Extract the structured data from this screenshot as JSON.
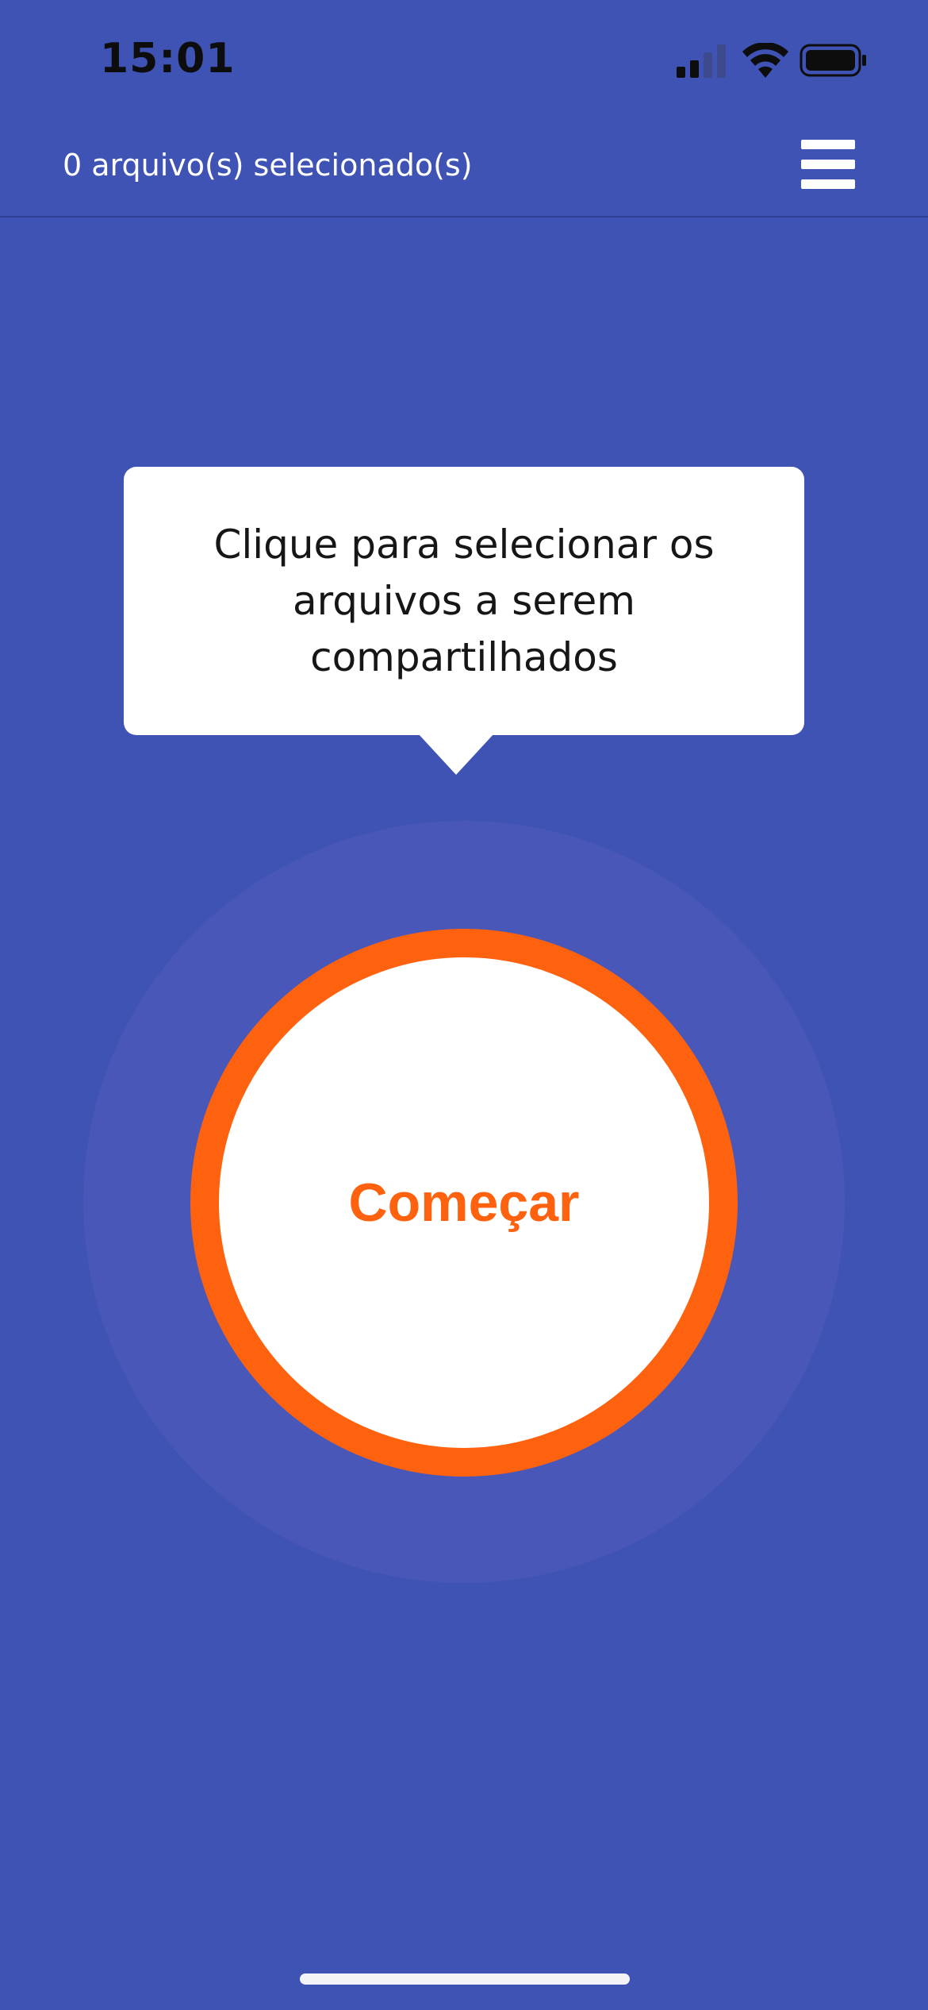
{
  "status_bar": {
    "time": "15:01",
    "icons": [
      "cellular-signal-icon",
      "wifi-icon",
      "battery-icon"
    ]
  },
  "header": {
    "title": "0 arquivo(s) selecionado(s)",
    "menu_icon": "hamburger-menu-icon"
  },
  "tooltip": {
    "text": "Clique para selecionar os arquivos a serem compartilhados"
  },
  "start_button": {
    "label": "Começar"
  },
  "colors": {
    "background": "#3F53B5",
    "halo": "#4857B8",
    "accent": "#FF620F",
    "tooltip_bg": "#FFFFFF"
  }
}
